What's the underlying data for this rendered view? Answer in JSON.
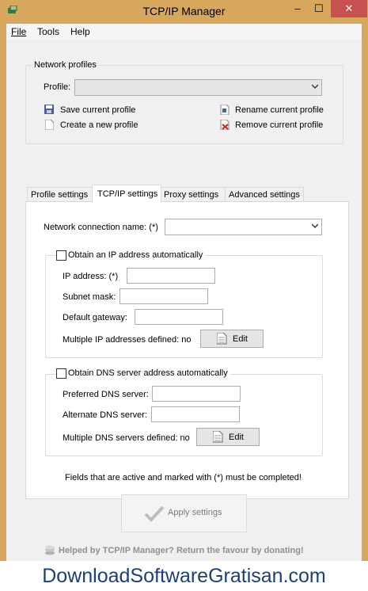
{
  "window": {
    "title": "TCP/IP Manager",
    "minimize": "–",
    "maximize": "☐",
    "close": "✕"
  },
  "menu": {
    "file": "File",
    "tools": "Tools",
    "help": "Help"
  },
  "profiles": {
    "group_title": "Network profiles",
    "profile_label": "Profile:",
    "profile_value": "",
    "save": "Save current profile",
    "create": "Create a new profile",
    "rename": "Rename current profile",
    "remove": "Remove current profile"
  },
  "tabs": [
    "Profile settings",
    "TCP/IP settings",
    "Proxy settings",
    "Advanced settings"
  ],
  "tcpip": {
    "conn_label": "Network connection name: (*)",
    "conn_value": "",
    "ip_group": "Obtain an IP address automatically",
    "ip_label": "IP address: (*)",
    "subnet_label": "Subnet mask:",
    "gateway_label": "Default gateway:",
    "multi_ip": "Multiple IP addresses defined: no",
    "edit": "Edit",
    "dns_group": "Obtain DNS server address automatically",
    "pref_dns": "Preferred DNS server:",
    "alt_dns": "Alternate DNS server:",
    "multi_dns": "Multiple DNS servers defined: no",
    "note": "Fields that are active and marked with (*) must be completed!"
  },
  "apply": "Apply settings",
  "donate": "Helped by TCP/IP Manager? Return the favour by donating!",
  "watermark": "DownloadSoftwareGratisan.com"
}
